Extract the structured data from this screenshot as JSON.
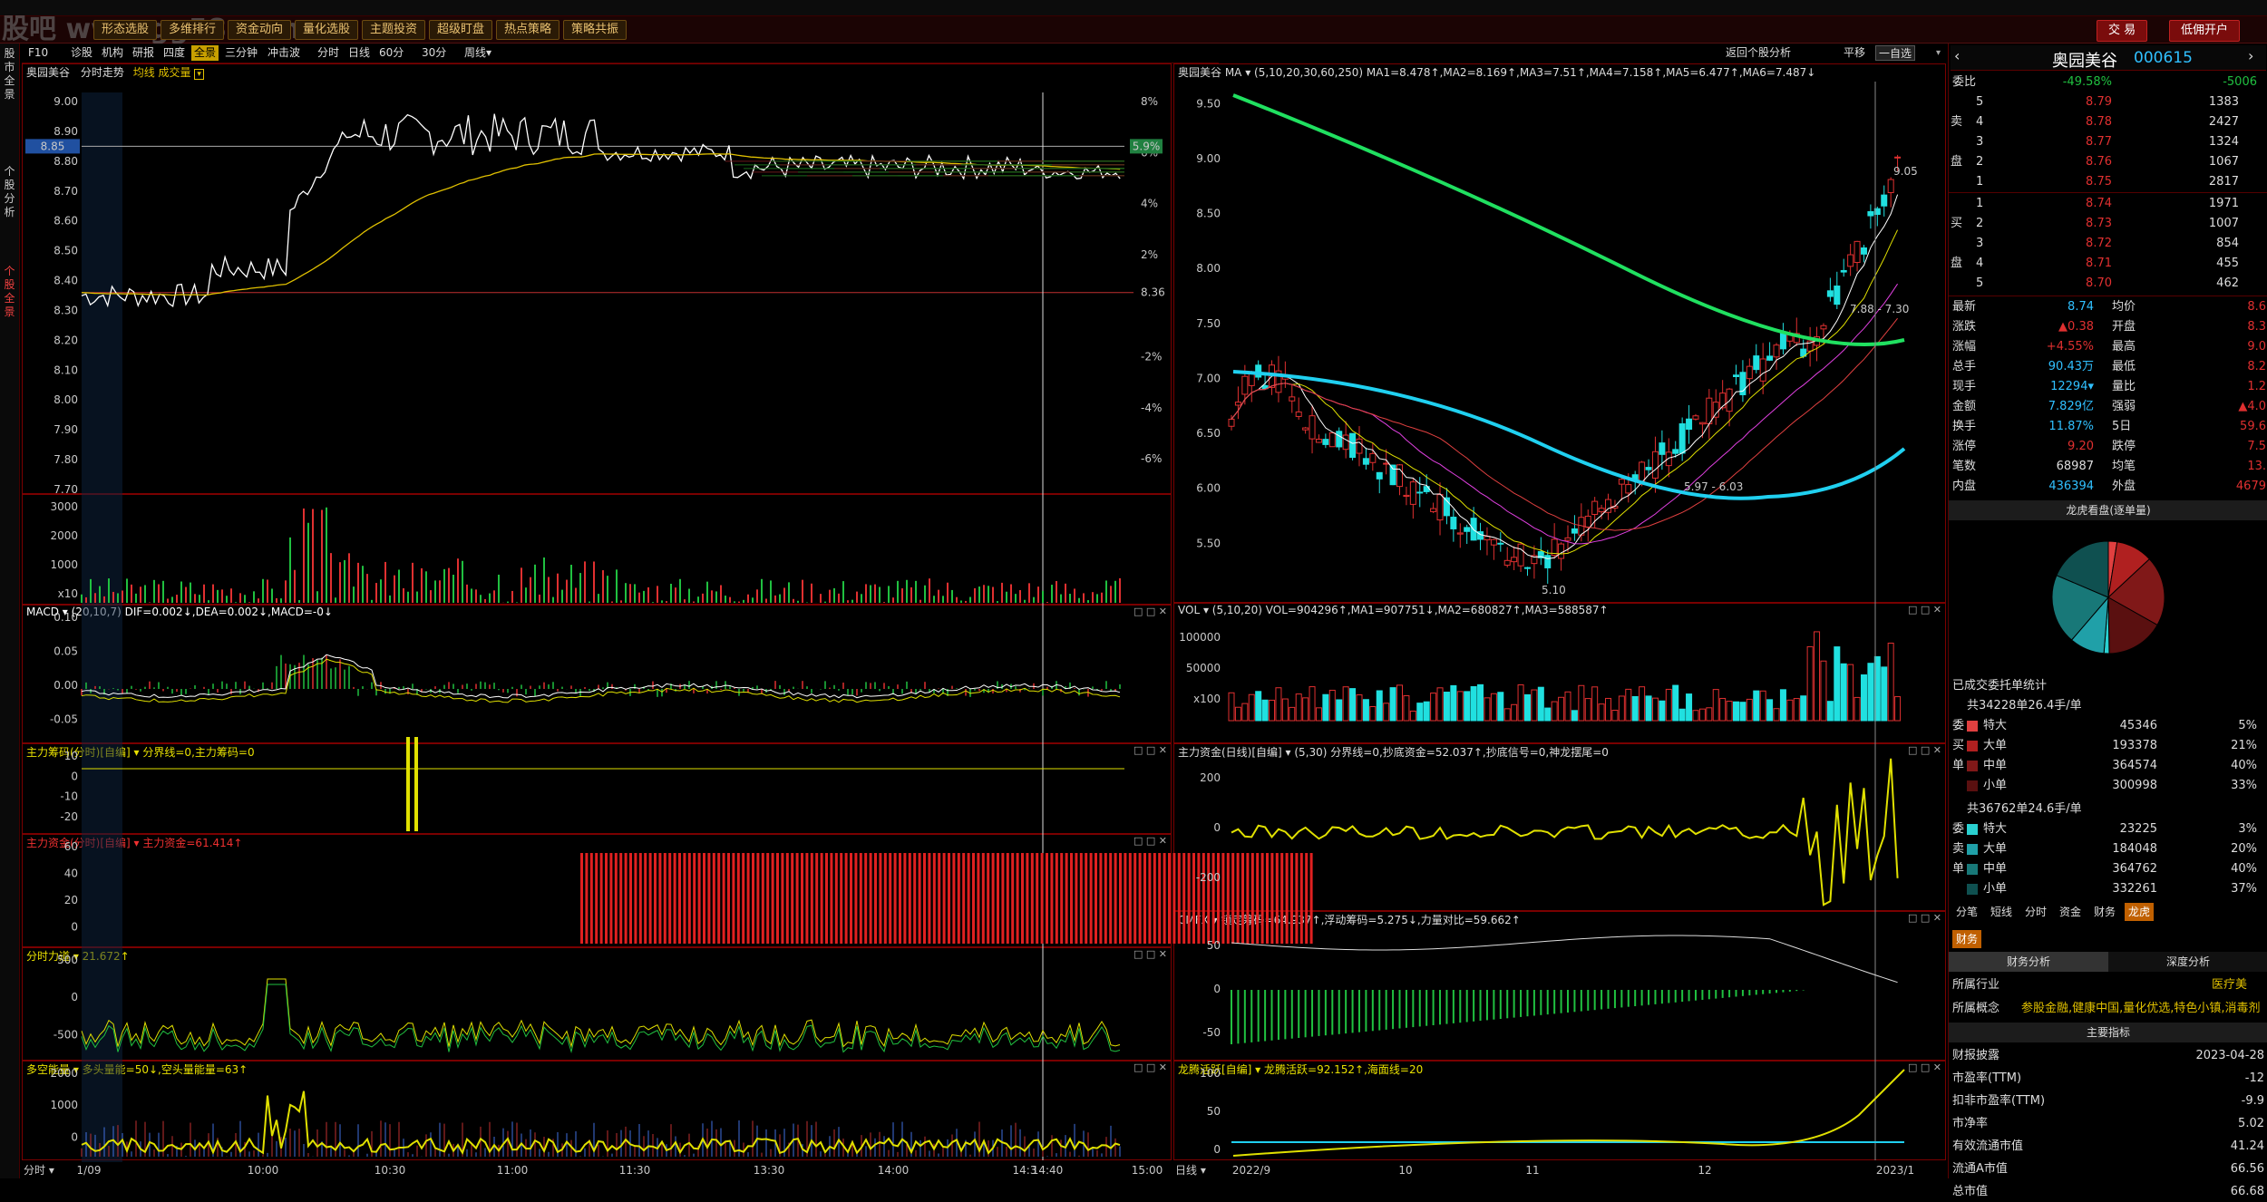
{
  "watermark": "股吧 www.gg58.com",
  "toolbar": {
    "buttons": [
      "形态选股",
      "多维排行",
      "资金动向",
      "量化选股",
      "主题投资",
      "超级盯盘",
      "热点策略",
      "策略共振"
    ],
    "trade": "交 易",
    "margin": "低佣开户"
  },
  "left_tabs": [
    "股市全景",
    "个股分析",
    "个股全景"
  ],
  "period_bar": {
    "items": [
      "F10",
      "诊股",
      "机构",
      "研报",
      "四度",
      "全景",
      "三分钟",
      "冲击波",
      "分时",
      "日线",
      "60分",
      "30分",
      "周线▾"
    ],
    "active": "全景"
  },
  "period_bar2": {
    "back": "返回个股分析",
    "flat": "平移",
    "select": "一自选"
  },
  "intraday": {
    "title": "奥园美谷",
    "mode": "分时走势",
    "sub": "均线 成交量",
    "price_labels": [
      "9.00",
      "8.90",
      "8.80",
      "8.70",
      "8.60",
      "8.50",
      "8.40",
      "8.30",
      "8.20",
      "8.10",
      "8.00",
      "7.90",
      "7.80",
      "7.70"
    ],
    "pct_labels": [
      "8%",
      "6%",
      "4%",
      "2%",
      "",
      "-2%",
      "-4%",
      "-6%"
    ],
    "current_price": "8.85",
    "current_pct": "5.9%",
    "prev_close": "8.36",
    "volume_labels": [
      "3000",
      "2000",
      "1000",
      "x10"
    ],
    "time_labels": [
      "1/09",
      "10:00",
      "10:30",
      "11:00",
      "11:30",
      "13:30",
      "14:00",
      "14:3",
      "14:40",
      "15:00"
    ],
    "bottom_left": "分时 ▾"
  },
  "intraday_panels": [
    {
      "name": "macd",
      "title": "MACD ▾ (20,10,7) DIF=0.002↓,DEA=0.002↓,MACD=-0↓",
      "labels": [
        "0.10",
        "0.05",
        "0.00",
        "-0.05"
      ]
    },
    {
      "name": "main-chips",
      "title": "主力筹码(分时)[自编] ▾ 分界线=0,主力筹码=0",
      "labels": [
        "10",
        "0",
        "-10",
        "-20"
      ]
    },
    {
      "name": "main-funds",
      "title": "主力资金(分时)[自编] ▾ 主力资金=61.414↑",
      "labels": [
        "60",
        "40",
        "20",
        "0"
      ]
    },
    {
      "name": "intraday-force",
      "title": "分时力道 ▾ 21.672↑",
      "labels": [
        "500",
        "0",
        "-500"
      ]
    },
    {
      "name": "long-short",
      "title": "多空能量 ▾ 多头量能=50↓,空头量能量=63↑",
      "labels": [
        "2000",
        "1000",
        "0"
      ]
    }
  ],
  "kline": {
    "title": "奥园美谷 MA ▾ (5,10,20,30,60,250) MA1=8.478↑,MA2=8.169↑,MA3=7.51↑,MA4=7.158↑,MA5=6.477↑,MA6=7.487↓",
    "price_labels": [
      "9.50",
      "9.00",
      "8.50",
      "8.00",
      "7.50",
      "7.00",
      "6.50",
      "6.00",
      "5.50"
    ],
    "annotations": {
      "high": "9.05",
      "low": "5.10",
      "range1": "7.88 - 7.30",
      "range2": "5.97 - 6.03"
    },
    "date_labels": [
      "2022/9",
      "10",
      "11",
      "12",
      "2023/1"
    ],
    "bottom_left": "日线 ▾"
  },
  "kline_panels": [
    {
      "name": "vol",
      "title": "VOL ▾ (5,10,20) VOL=904296↑,MA1=907751↓,MA2=680827↑,MA3=588587↑",
      "labels": [
        "100000",
        "50000",
        "x100"
      ]
    },
    {
      "name": "funds",
      "title": "主力资金(日线)[自编] ▾ (5,30) 分界线=0,抄底资金=52.037↑,抄底信号=0,神龙摆尾=0",
      "labels": [
        "200",
        "0",
        "-200"
      ]
    },
    {
      "name": "cmfx",
      "title": "CMFX ▾ 锁定筹码=64.937↑,浮动筹码=5.275↓,力量对比=59.662↑",
      "labels": [
        "50",
        "0",
        "-50"
      ]
    },
    {
      "name": "dragon",
      "title": "龙腾活跃[自编] ▾ 龙腾活跃=92.152↑,海面线=20",
      "labels": [
        "100",
        "50",
        "0"
      ]
    }
  ],
  "quote": {
    "name": "奥园美谷",
    "code": "000615",
    "weibi_label": "委比",
    "weibi": "-49.58%",
    "weicha": "-5006",
    "asks": [
      {
        "l": "5",
        "p": "8.79",
        "v": "1383"
      },
      {
        "l": "4",
        "p": "8.78",
        "v": "2427"
      },
      {
        "l": "3",
        "p": "8.77",
        "v": "1324"
      },
      {
        "l": "2",
        "p": "8.76",
        "v": "1067"
      },
      {
        "l": "1",
        "p": "8.75",
        "v": "2817"
      }
    ],
    "bids": [
      {
        "l": "1",
        "p": "8.74",
        "v": "1971"
      },
      {
        "l": "2",
        "p": "8.73",
        "v": "1007"
      },
      {
        "l": "3",
        "p": "8.72",
        "v": "854"
      },
      {
        "l": "4",
        "p": "8.71",
        "v": "455"
      },
      {
        "l": "5",
        "p": "8.70",
        "v": "462"
      }
    ],
    "ask_side": [
      "卖",
      "盘"
    ],
    "bid_side": [
      "买",
      "盘"
    ],
    "stats": [
      {
        "k": "最新",
        "v": "8.74",
        "k2": "均价",
        "v2": "8.6"
      },
      {
        "k": "涨跌",
        "v": "▲0.38",
        "k2": "开盘",
        "v2": "8.3"
      },
      {
        "k": "涨幅",
        "v": "+4.55%",
        "k2": "最高",
        "v2": "9.0"
      },
      {
        "k": "总手",
        "v": "90.43万",
        "k2": "最低",
        "v2": "8.2"
      },
      {
        "k": "现手",
        "v": "12294▾",
        "k2": "量比",
        "v2": "1.2"
      },
      {
        "k": "金额",
        "v": "7.829亿",
        "k2": "强弱",
        "v2": "▲4.0"
      },
      {
        "k": "换手",
        "v": "11.87%",
        "k2": "5日",
        "v2": "59.6"
      },
      {
        "k": "涨停",
        "v": "9.20",
        "k2": "跌停",
        "v2": "7.5"
      },
      {
        "k": "笔数",
        "v": "68987",
        "k2": "均笔",
        "v2": "13."
      },
      {
        "k": "内盘",
        "v": "436394",
        "k2": "外盘",
        "v2": "4679"
      }
    ],
    "pie_title": "龙虎看盘(逐单量)",
    "pie_slices": [
      {
        "name": "特大-买",
        "value": 5,
        "color": "#e04040"
      },
      {
        "name": "大单-买",
        "value": 21,
        "color": "#b02020"
      },
      {
        "name": "中单-买",
        "value": 40,
        "color": "#801818"
      },
      {
        "name": "小单-买",
        "value": 33,
        "color": "#5a1010"
      },
      {
        "name": "特大-卖",
        "value": 3,
        "color": "#2ad0d0"
      },
      {
        "name": "大单-卖",
        "value": 20,
        "color": "#20a0a8"
      },
      {
        "name": "中单-卖",
        "value": 40,
        "color": "#187878"
      },
      {
        "name": "小单-卖",
        "value": 37,
        "color": "#0f5050"
      }
    ],
    "entrust_title": "已成交委托单统计",
    "buy_total": "共34228单26.4手/单",
    "buy_rows": [
      {
        "n": "特大",
        "v": "45346",
        "p": "5%"
      },
      {
        "n": "大单",
        "v": "193378",
        "p": "21%"
      },
      {
        "n": "中单",
        "v": "364574",
        "p": "40%"
      },
      {
        "n": "小单",
        "v": "300998",
        "p": "33%"
      }
    ],
    "buy_side": [
      "委",
      "买",
      "单"
    ],
    "sell_total": "共36762单24.6手/单",
    "sell_rows": [
      {
        "n": "特大",
        "v": "23225",
        "p": "3%"
      },
      {
        "n": "大单",
        "v": "184048",
        "p": "20%"
      },
      {
        "n": "中单",
        "v": "364762",
        "p": "40%"
      },
      {
        "n": "小单",
        "v": "332261",
        "p": "37%"
      }
    ],
    "sell_side": [
      "委",
      "卖",
      "单"
    ],
    "tabs": [
      "分笔",
      "短线",
      "分时",
      "资金",
      "财务",
      "龙虎"
    ],
    "active_tab": "龙虎",
    "finance_tag": "财务",
    "fin_tabs": [
      "财务分析",
      "深度分析"
    ],
    "industry_label": "所属行业",
    "industry": "医疗美",
    "concept_label": "所属概念",
    "concept": "参股金融,健康中国,量化优选,特色小镇,消毒剂",
    "main_index": "主要指标",
    "metrics": [
      {
        "k": "财报披露",
        "v": "2023-04-28"
      },
      {
        "k": "市盈率(TTM)",
        "v": "-12"
      },
      {
        "k": "扣非市盈率(TTM)",
        "v": "-9.9"
      },
      {
        "k": "市净率",
        "v": "5.02"
      },
      {
        "k": "有效流通市值",
        "v": "41.24"
      },
      {
        "k": "流通A市值",
        "v": "66.56"
      },
      {
        "k": "总市值",
        "v": "66.68"
      }
    ]
  }
}
